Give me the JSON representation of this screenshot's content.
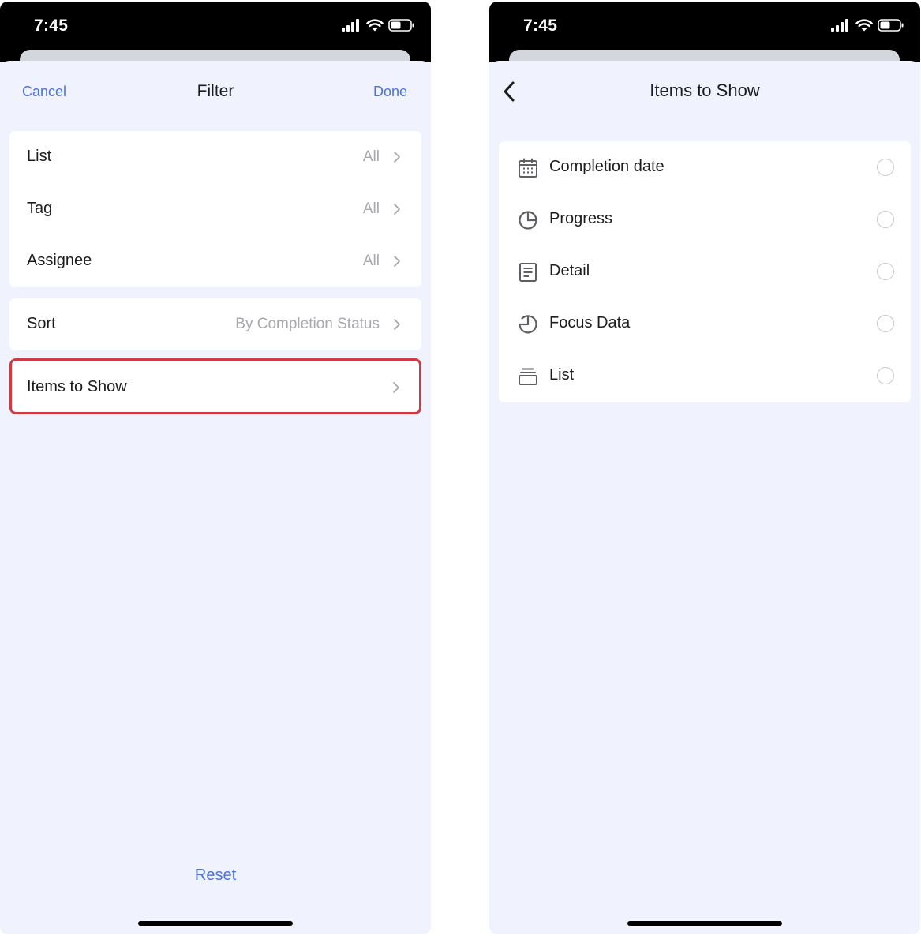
{
  "left_screen": {
    "status": {
      "time": "7:45"
    },
    "nav": {
      "cancel": "Cancel",
      "title": "Filter",
      "done": "Done"
    },
    "filters": [
      {
        "label": "List",
        "value": "All"
      },
      {
        "label": "Tag",
        "value": "All"
      },
      {
        "label": "Assignee",
        "value": "All"
      }
    ],
    "sort": {
      "label": "Sort",
      "value": "By Completion Status"
    },
    "items_to_show": {
      "label": "Items to Show",
      "highlight_color": "#d03b43"
    },
    "reset": "Reset"
  },
  "right_screen": {
    "status": {
      "time": "7:45"
    },
    "nav": {
      "title": "Items to Show"
    },
    "options": [
      {
        "label": "Completion date",
        "icon": "calendar-icon",
        "selected": false
      },
      {
        "label": "Progress",
        "icon": "pie-chart-icon",
        "selected": false
      },
      {
        "label": "Detail",
        "icon": "document-icon",
        "selected": false
      },
      {
        "label": "Focus Data",
        "icon": "focus-clock-icon",
        "selected": false
      },
      {
        "label": "List",
        "icon": "stack-icon",
        "selected": false
      }
    ]
  },
  "colors": {
    "accent": "#4c73d6",
    "background": "#f0f3fd",
    "status_bar": "#000000"
  }
}
